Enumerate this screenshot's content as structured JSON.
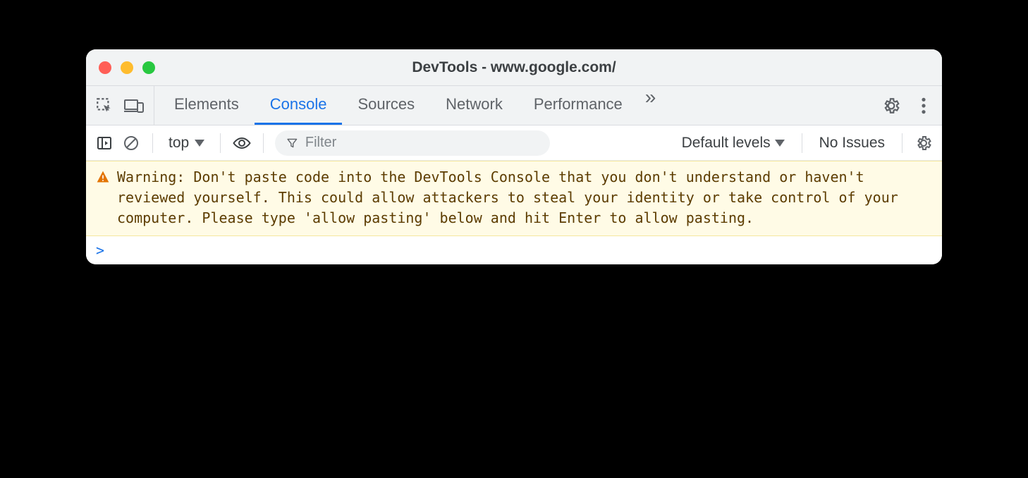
{
  "window": {
    "title": "DevTools - www.google.com/"
  },
  "tabs": {
    "items": [
      "Elements",
      "Console",
      "Sources",
      "Network",
      "Performance"
    ],
    "active_index": 1,
    "more_glyph": "»"
  },
  "toolbar": {
    "context": "top",
    "filter_placeholder": "Filter",
    "levels_label": "Default levels",
    "issues_label": "No Issues"
  },
  "console": {
    "warning_text": "Warning: Don't paste code into the DevTools Console that you don't understand or haven't reviewed yourself. This could allow attackers to steal your identity or take control of your computer. Please type 'allow pasting' below and hit Enter to allow pasting.",
    "prompt_marker": ">"
  }
}
